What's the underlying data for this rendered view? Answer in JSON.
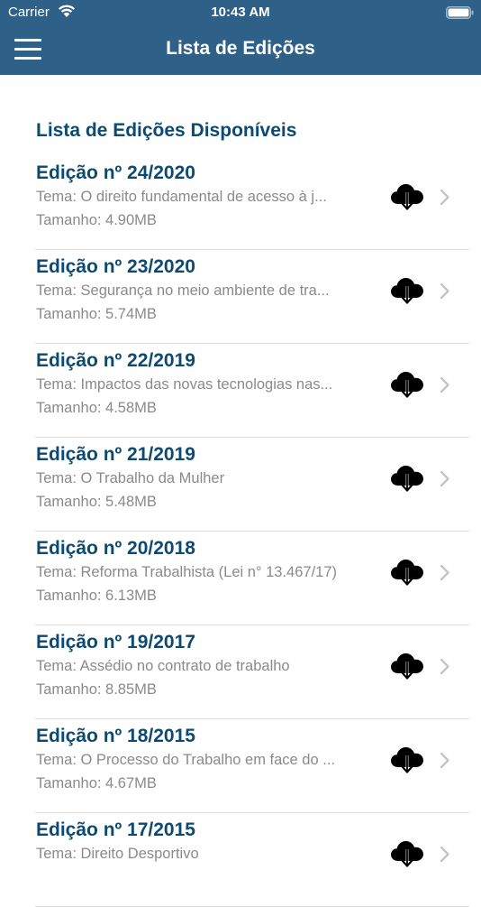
{
  "status_bar": {
    "carrier": "Carrier",
    "time": "10:43 AM",
    "wifi_icon": "wifi-icon",
    "battery_icon": "battery-icon"
  },
  "header": {
    "title": "Lista de Edições",
    "menu_icon": "hamburger-menu-icon",
    "background_color": "#2f6188"
  },
  "section_title": "Lista de Edições Disponíveis",
  "colors": {
    "accent": "#0d4a72",
    "secondary_text": "#8a8a8a"
  },
  "editions": [
    {
      "title": "Edição nº 24/2020",
      "theme": "Tema: O direito fundamental de acesso à j...",
      "size": "Tamanho: 4.90MB"
    },
    {
      "title": "Edição nº 23/2020",
      "theme": "Tema: Segurança no meio ambiente de tra...",
      "size": "Tamanho: 5.74MB"
    },
    {
      "title": "Edição nº 22/2019",
      "theme": "Tema: Impactos das novas tecnologias nas...",
      "size": "Tamanho: 4.58MB"
    },
    {
      "title": "Edição nº 21/2019",
      "theme": "Tema: O Trabalho da Mulher",
      "size": "Tamanho: 5.48MB"
    },
    {
      "title": "Edição nº 20/2018",
      "theme": "Tema: Reforma Trabalhista (Lei n° 13.467/17)",
      "size": "Tamanho: 6.13MB"
    },
    {
      "title": "Edição nº 19/2017",
      "theme": "Tema: Assédio no contrato de trabalho",
      "size": "Tamanho: 8.85MB"
    },
    {
      "title": "Edição nº 18/2015",
      "theme": "Tema: O Processo do Trabalho em face do ...",
      "size": "Tamanho: 4.67MB"
    },
    {
      "title": "Edição nº 17/2015",
      "theme": "Tema: Direito Desportivo",
      "size": ""
    }
  ],
  "row_icons": {
    "download": "cloud-download-icon",
    "disclosure": "chevron-right-icon"
  }
}
